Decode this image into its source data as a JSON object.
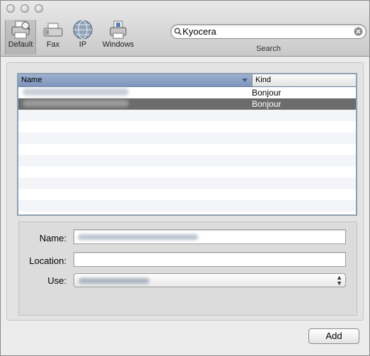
{
  "window": {
    "title": ""
  },
  "toolbar": {
    "items": [
      {
        "label": "Default",
        "icon": "printer-icon"
      },
      {
        "label": "Fax",
        "icon": "fax-icon"
      },
      {
        "label": "IP",
        "icon": "globe-icon"
      },
      {
        "label": "Windows",
        "icon": "windows-printer-icon"
      }
    ],
    "search": {
      "value": "Kyocera",
      "label": "Search"
    }
  },
  "table": {
    "columns": [
      "Name",
      "Kind"
    ],
    "rows": [
      {
        "name": "",
        "kind": "Bonjour",
        "selected": false
      },
      {
        "name": "",
        "kind": "Bonjour",
        "selected": true
      }
    ]
  },
  "form": {
    "name_label": "Name:",
    "location_label": "Location:",
    "use_label": "Use:",
    "location_value": ""
  },
  "buttons": {
    "add": "Add"
  }
}
